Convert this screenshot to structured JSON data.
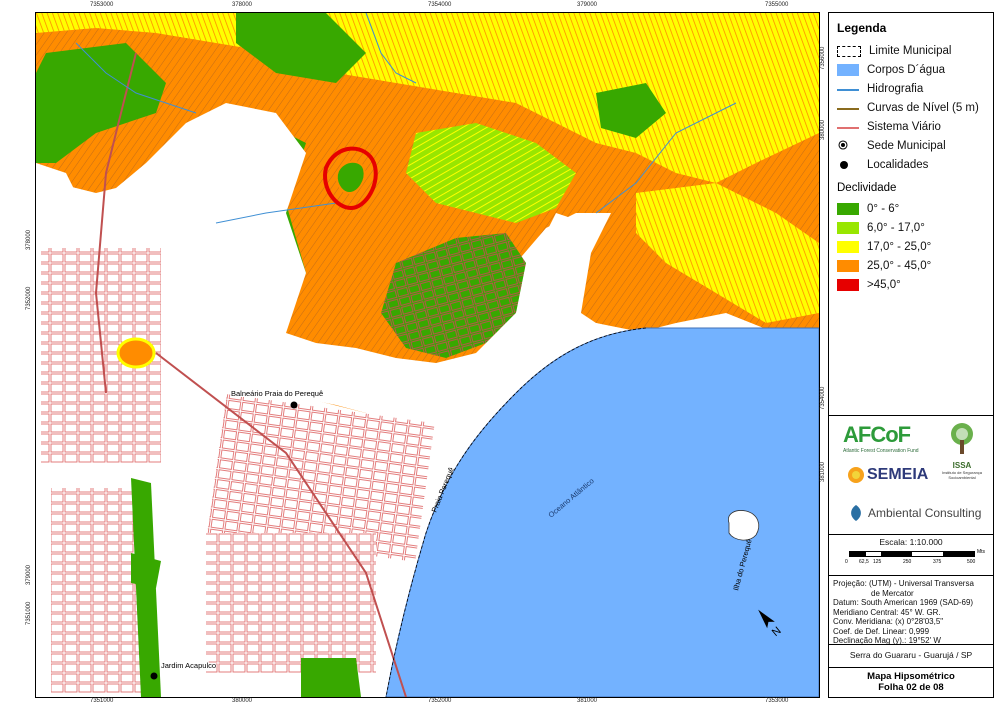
{
  "coords": {
    "top": [
      "7353000",
      "378000",
      "7354000",
      "379000",
      "7355000"
    ],
    "bottom": [
      "7351000",
      "380000",
      "7352000",
      "381000",
      "7353000"
    ],
    "left": [
      "378000",
      "7352000",
      "379000",
      "7351000"
    ],
    "right": [
      "7356000",
      "380000",
      "7354000",
      "381000"
    ]
  },
  "map_labels": {
    "locality_1": "Balneário Praia do Perequê",
    "locality_2": "Jardim Acapulco",
    "beach": "Praia Perequê",
    "ocean": "Oceano Atlântico",
    "island": "Ilha do Perequê"
  },
  "legend": {
    "title": "Legenda",
    "items": [
      {
        "label": "Limite Municipal",
        "symbol": "dashed-box"
      },
      {
        "label": "Corpos D´água",
        "symbol": "fill",
        "color": "#73b2ff"
      },
      {
        "label": "Hidrografia",
        "symbol": "line",
        "color": "#3f8fd4"
      },
      {
        "label": "Curvas de Nível (5 m)",
        "symbol": "line",
        "color": "#8a6b1e"
      },
      {
        "label": "Sistema Viário",
        "symbol": "line",
        "color": "#e07070"
      },
      {
        "label": "Sede Municipal",
        "symbol": "dot-ring"
      },
      {
        "label": "Localidades",
        "symbol": "dot"
      }
    ],
    "declividade_title": "Declividade",
    "classes": [
      {
        "label": "0° - 6°",
        "color": "#38a800"
      },
      {
        "label": "6,0° - 17,0°",
        "color": "#98e600"
      },
      {
        "label": "17,0° - 25,0°",
        "color": "#ffff00"
      },
      {
        "label": "25,0° - 45,0°",
        "color": "#ff8c00"
      },
      {
        "label": ">45,0°",
        "color": "#e60000"
      }
    ]
  },
  "logos": {
    "afcof": "AFCoF",
    "afcof_sub": "Atlantic Forest Conservation Fund",
    "semeia": "SEMEIA",
    "issa": "ISSA",
    "issa_sub": "Instituto de Segurança Socioambiental",
    "ambiental": "Ambiental Consulting"
  },
  "scale": {
    "title": "Escala: 1:10.000",
    "ticks": [
      "0",
      "62,5",
      "125",
      "250",
      "375",
      "500"
    ],
    "unit": "Mts"
  },
  "projection": [
    "Projeção: (UTM) - Universal Transversa",
    "de Mercator",
    "Datum: South American 1969 (SAD-69)",
    "Meridiano Central: 45° W. GR.",
    "Conv. Meridiana: (x) 0°28'03,5\"",
    "Coef. de Def. Linear: 0,999",
    "Declinação Mag (y).: 19°52' W"
  ],
  "place": "Serra do Guararu - Guarujá / SP",
  "map_title": "Mapa Hipsométrico",
  "sheet": "Folha 02 de 08"
}
